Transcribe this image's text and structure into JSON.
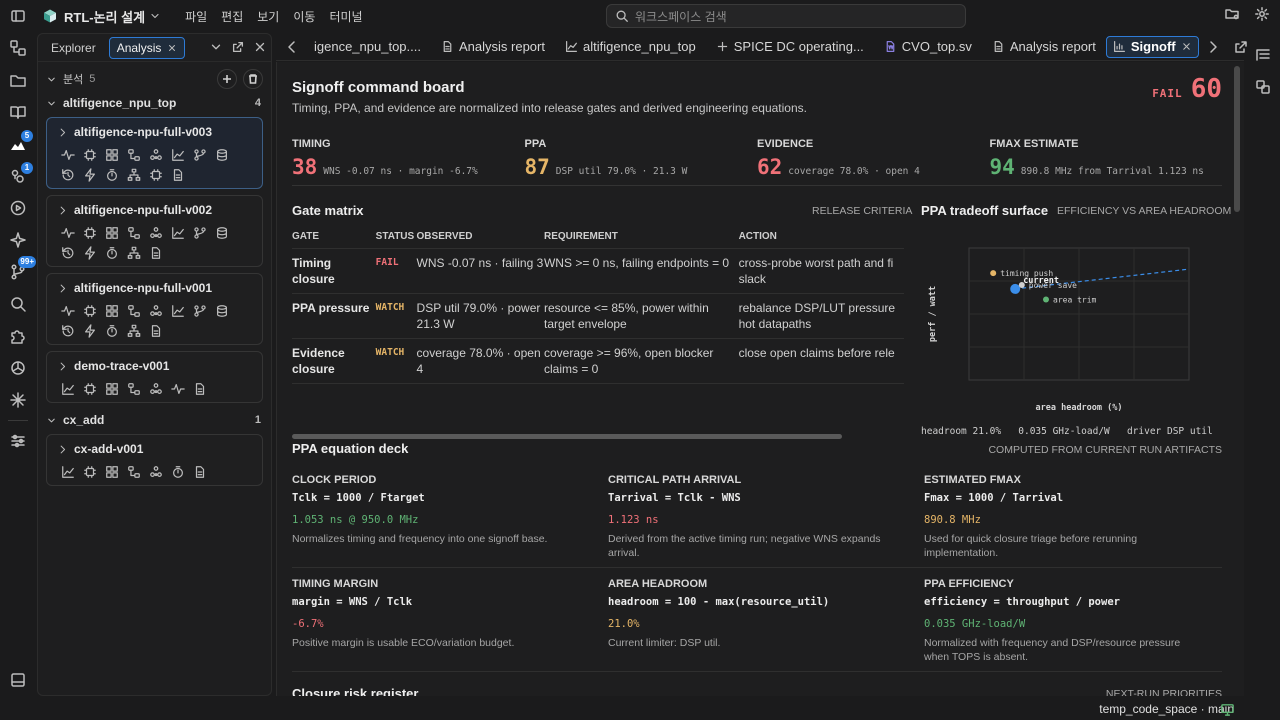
{
  "app": {
    "title": "RTL-논리 설계",
    "menu": [
      "파일",
      "편집",
      "보기",
      "이동",
      "터미널"
    ],
    "search_placeholder": "워크스페이스 검색"
  },
  "activity": {
    "badges": {
      "runs": "5",
      "source": "1",
      "issues": "99+"
    }
  },
  "sidebar": {
    "tabs": [
      "Explorer",
      "Analysis"
    ],
    "section": {
      "label": "분석",
      "count": "5"
    },
    "groups": [
      {
        "name": "altifigence_npu_top",
        "count": "4",
        "items": [
          {
            "name": "altifigence-npu-full-v003",
            "row1": [
              "activity",
              "chip",
              "grid",
              "flow",
              "cluster",
              "chart",
              "branch",
              "database"
            ],
            "row2": [
              "history",
              "bolt",
              "timer",
              "tree",
              "chip",
              "document"
            ]
          },
          {
            "name": "altifigence-npu-full-v002",
            "row1": [
              "activity",
              "chip",
              "grid",
              "flow",
              "cluster",
              "chart",
              "branch",
              "database"
            ],
            "row2": [
              "history",
              "bolt",
              "timer",
              "tree",
              "document"
            ]
          },
          {
            "name": "altifigence-npu-full-v001",
            "row1": [
              "activity",
              "chip",
              "grid",
              "flow",
              "cluster",
              "chart",
              "branch",
              "database"
            ],
            "row2": [
              "history",
              "bolt",
              "timer",
              "tree",
              "document"
            ]
          },
          {
            "name": "demo-trace-v001",
            "row1": [
              "chart",
              "chip",
              "grid",
              "flow",
              "cluster",
              "activity",
              "document"
            ],
            "row2": []
          }
        ]
      },
      {
        "name": "cx_add",
        "count": "1",
        "items": [
          {
            "name": "cx-add-v001",
            "row1": [
              "chart",
              "chip",
              "grid",
              "flow",
              "cluster",
              "timer",
              "document"
            ],
            "row2": []
          }
        ]
      }
    ]
  },
  "tabs": [
    "igence_npu_top....",
    "Analysis report",
    "altifigence_npu_top",
    "SPICE DC operating...",
    "CVO_top.sv",
    "Analysis report",
    "Signoff"
  ],
  "board": {
    "title": "Signoff command board",
    "subtitle": "Timing, PPA, and evidence are normalized into release gates and derived engineering equations.",
    "verdict_label": "FAIL",
    "verdict_score": "60",
    "metrics": [
      {
        "label": "TIMING",
        "value": "38",
        "detail": "WNS -0.07 ns · margin -6.7%",
        "color": "#f07178"
      },
      {
        "label": "PPA",
        "value": "87",
        "detail": "DSP util 79.0% · 21.3 W",
        "color": "#e5b567"
      },
      {
        "label": "EVIDENCE",
        "value": "62",
        "detail": "coverage 78.0% · open 4",
        "color": "#f07178"
      },
      {
        "label": "FMAX ESTIMATE",
        "value": "94",
        "detail": "890.8 MHz from Tarrival 1.123 ns",
        "color": "#5fb374"
      }
    ]
  },
  "gate_matrix": {
    "title": "Gate matrix",
    "criteria": "RELEASE CRITERIA",
    "headers": [
      "GATE",
      "STATUS",
      "OBSERVED",
      "REQUIREMENT",
      "ACTION"
    ],
    "rows": [
      {
        "gate": "Timing closure",
        "status": "FAIL",
        "status_color": "#f07178",
        "observed": "WNS -0.07 ns · failing 3",
        "requirement": "WNS >= 0 ns, failing endpoints = 0",
        "action": "cross-probe worst path and fi slack"
      },
      {
        "gate": "PPA pressure",
        "status": "WATCH",
        "status_color": "#e5b567",
        "observed": "DSP util 79.0% · power 21.3 W",
        "requirement": "resource <= 85%, power within target envelope",
        "action": "rebalance DSP/LUT pressure hot datapaths"
      },
      {
        "gate": "Evidence closure",
        "status": "WATCH",
        "status_color": "#e5b567",
        "observed": "coverage 78.0% · open 4",
        "requirement": "coverage >= 96%, open blocker claims = 0",
        "action": "close open claims before rele"
      }
    ]
  },
  "tradeoff": {
    "title": "PPA tradeoff surface",
    "subtitle": "EFFICIENCY VS AREA HEADROOM",
    "footer": [
      "headroom 21.0%",
      "0.035 GHz-load/W",
      "driver DSP util"
    ],
    "chart_data": {
      "type": "scatter",
      "xlabel": "area headroom (%)",
      "ylabel": "perf / watt",
      "xlim": [
        0,
        100
      ],
      "ylim": [
        0,
        100
      ],
      "points": [
        {
          "label": "timing push",
          "x": 11,
          "y": 81,
          "color": "#e5b567"
        },
        {
          "label": "current",
          "x": 21,
          "y": 69,
          "color": "#3b8eea"
        },
        {
          "label": "power save",
          "x": 24,
          "y": 72,
          "color": "#cfcfcf"
        },
        {
          "label": "area trim",
          "x": 35,
          "y": 61,
          "color": "#5fb374"
        }
      ],
      "trend": {
        "x": [
          21,
          100
        ],
        "y": [
          69,
          84
        ]
      },
      "grid": true
    }
  },
  "deck": {
    "title": "PPA equation deck",
    "subtitle": "COMPUTED FROM CURRENT RUN ARTIFACTS",
    "items": [
      {
        "label": "CLOCK PERIOD",
        "formula": "Tclk = 1000 / Ftarget",
        "value": "1.053 ns @ 950.0 MHz",
        "color": "#5fb374",
        "note": "Normalizes timing and frequency into one signoff base."
      },
      {
        "label": "CRITICAL PATH ARRIVAL",
        "formula": "Tarrival = Tclk - WNS",
        "value": "1.123 ns",
        "color": "#f07178",
        "note": "Derived from the active timing run; negative WNS expands arrival."
      },
      {
        "label": "ESTIMATED FMAX",
        "formula": "Fmax = 1000 / Tarrival",
        "value": "890.8 MHz",
        "color": "#e5b567",
        "note": "Used for quick closure triage before rerunning implementation."
      },
      {
        "label": "TIMING MARGIN",
        "formula": "margin = WNS / Tclk",
        "value": "-6.7%",
        "color": "#f07178",
        "note": "Positive margin is usable ECO/variation budget."
      },
      {
        "label": "AREA HEADROOM",
        "formula": "headroom = 100 - max(resource_util)",
        "value": "21.0%",
        "color": "#e5b567",
        "note": "Current limiter: DSP util."
      },
      {
        "label": "PPA EFFICIENCY",
        "formula": "efficiency = throughput / power",
        "value": "0.035 GHz-load/W",
        "color": "#5fb374",
        "note": "Normalized with frequency and DSP/resource pressure when TOPS is absent."
      }
    ]
  },
  "risk": {
    "title": "Closure risk register",
    "subtitle": "NEXT-RUN PRIORITIES"
  },
  "status": {
    "workspace": "temp_code_space · main"
  }
}
